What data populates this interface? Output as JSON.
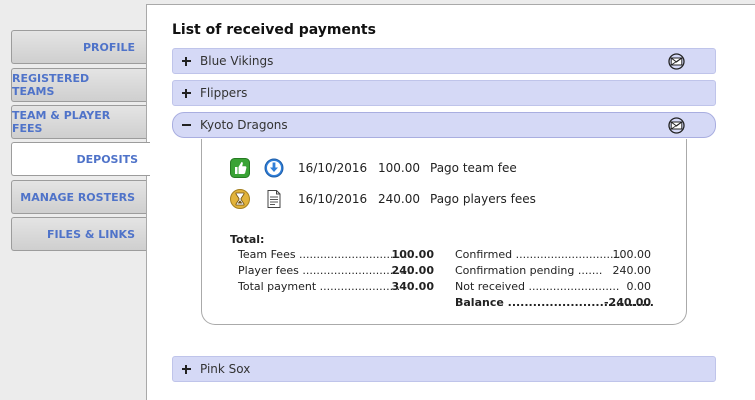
{
  "sidebar": {
    "items": [
      {
        "label": "PROFILE",
        "active": false
      },
      {
        "label": "REGISTERED TEAMS",
        "active": false
      },
      {
        "label": "TEAM & PLAYER FEES",
        "active": false
      },
      {
        "label": "DEPOSITS",
        "active": true
      },
      {
        "label": "MANAGE ROSTERS",
        "active": false
      },
      {
        "label": "FILES & LINKS",
        "active": false
      }
    ]
  },
  "main": {
    "title": "List of received payments",
    "teams": [
      {
        "name": "Blue Vikings",
        "expanded": false,
        "mail_icon": true
      },
      {
        "name": "Flippers",
        "expanded": false,
        "mail_icon": false
      },
      {
        "name": "Kyoto Dragons",
        "expanded": true,
        "mail_icon": true
      },
      {
        "name": "Pink Sox",
        "expanded": false,
        "mail_icon": false
      }
    ],
    "payments": [
      {
        "status_icon": "thumbs-up-icon",
        "action_icon": "download-icon",
        "date": "16/10/2016",
        "amount": "100.00",
        "description": "Pago team fee"
      },
      {
        "status_icon": "hourglass-icon",
        "action_icon": "document-icon",
        "date": "16/10/2016",
        "amount": "240.00",
        "description": "Pago players fees"
      }
    ],
    "totals": {
      "label": "Total:",
      "team_fees_label": "Team Fees ...............................",
      "team_fees_value": "100.00",
      "player_fees_label": "Player fees ...............................",
      "player_fees_value": "240.00",
      "total_payment_label": "Total payment .......................",
      "total_payment_value": "340.00",
      "confirmed_label": "Confirmed ...............................",
      "confirmed_value": "100.00",
      "pending_label": "Confirmation pending .......",
      "pending_value": "240.00",
      "not_received_label": "Not received ..........................",
      "not_received_value": "0.00",
      "balance_label": "Balance ...................................",
      "balance_value": "-240.00"
    }
  },
  "colors": {
    "accent": "#4f73c9",
    "bar_bg": "#d5d9f6",
    "ok_green": "#3aa335",
    "pending_gold": "#e2b33b"
  }
}
